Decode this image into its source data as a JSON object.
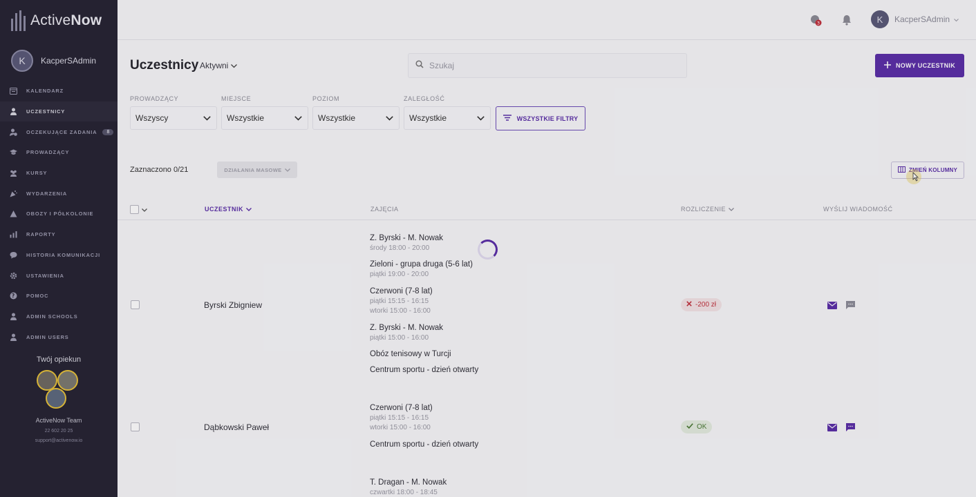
{
  "app": {
    "brand_light": "Active",
    "brand_bold": "Now"
  },
  "sidebar": {
    "user_initial": "K",
    "user_name": "KacperSAdmin",
    "items": [
      {
        "label": "Kalendarz",
        "icon": "calendar-icon"
      },
      {
        "label": "Uczestnicy",
        "icon": "person-icon",
        "active": true
      },
      {
        "label": "Oczekujące zadania",
        "icon": "person-clock-icon",
        "badge": "8"
      },
      {
        "label": "Prowadzący",
        "icon": "graduation-cap-icon"
      },
      {
        "label": "Kursy",
        "icon": "group-icon"
      },
      {
        "label": "Wydarzenia",
        "icon": "party-icon"
      },
      {
        "label": "Obozy i półkolonie",
        "icon": "tent-icon"
      },
      {
        "label": "Raporty",
        "icon": "chart-icon"
      },
      {
        "label": "Historia komunikacji",
        "icon": "chat-icon"
      },
      {
        "label": "Ustawienia",
        "icon": "gear-icon"
      },
      {
        "label": "Pomoc",
        "icon": "help-icon"
      },
      {
        "label": "Admin schools",
        "icon": "person-icon"
      },
      {
        "label": "Admin users",
        "icon": "person-icon"
      }
    ],
    "opiekun": {
      "title": "Twój opiekun",
      "team": "ActiveNow Team",
      "phone": "22 602 20 25",
      "email": "support@activenow.io"
    }
  },
  "topbar": {
    "notification_count": "3",
    "user_initial": "K",
    "user_name": "KacperSAdmin"
  },
  "header": {
    "title": "Uczestnicy",
    "status_filter": "Aktywni",
    "search_placeholder": "Szukaj",
    "new_button": "Nowy uczestnik"
  },
  "filters": [
    {
      "label": "Prowadzący",
      "value": "Wszyscy"
    },
    {
      "label": "Miejsce",
      "value": "Wszystkie"
    },
    {
      "label": "Poziom",
      "value": "Wszystkie"
    },
    {
      "label": "Zaległość",
      "value": "Wszystkie"
    }
  ],
  "all_filters_button": "Wszystkie filtry",
  "selection": {
    "count_text": "Zaznaczono 0/21",
    "bulk_button": "Działania masowe",
    "columns_button": "Zmień kolumny"
  },
  "table": {
    "headers": {
      "participant": "Uczestnik",
      "classes": "Zajęcia",
      "billing": "Rozliczenie",
      "message": "Wyślij wiadomość"
    },
    "rows": [
      {
        "name": "Byrski Zbigniew",
        "classes": [
          {
            "name": "Z. Byrski - M. Nowak",
            "times": [
              "środy 18:00 - 20:00"
            ]
          },
          {
            "name": "Zieloni - grupa druga (5-6 lat)",
            "times": [
              "piątki 19:00 - 20:00"
            ]
          },
          {
            "name": "Czerwoni (7-8 lat)",
            "times": [
              "piątki 15:15 - 16:15",
              "wtorki 15:00 - 16:00"
            ]
          },
          {
            "name": "Z. Byrski - M. Nowak",
            "times": [
              "piątki 15:00 - 16:00"
            ]
          },
          {
            "name": "Obóz tenisowy w Turcji",
            "times": []
          },
          {
            "name": "Centrum sportu - dzień otwarty",
            "times": []
          }
        ],
        "billing": "-200 zł",
        "billing_status": "negative"
      },
      {
        "name": "Dąbkowski Paweł",
        "classes": [
          {
            "name": "Czerwoni (7-8 lat)",
            "times": [
              "piątki 15:15 - 16:15",
              "wtorki 15:00 - 16:00"
            ]
          },
          {
            "name": "Centrum sportu - dzień otwarty",
            "times": []
          }
        ],
        "billing": "OK",
        "billing_status": "ok"
      },
      {
        "name": "",
        "classes": [
          {
            "name": "T. Dragan - M. Nowak",
            "times": [
              "czwartki 18:00 - 18:45"
            ]
          }
        ]
      }
    ]
  },
  "colors": {
    "accent": "#5b2fa8",
    "sidebar_bg": "#262433",
    "negative": "#c0303c",
    "ok": "#4b7a36"
  }
}
